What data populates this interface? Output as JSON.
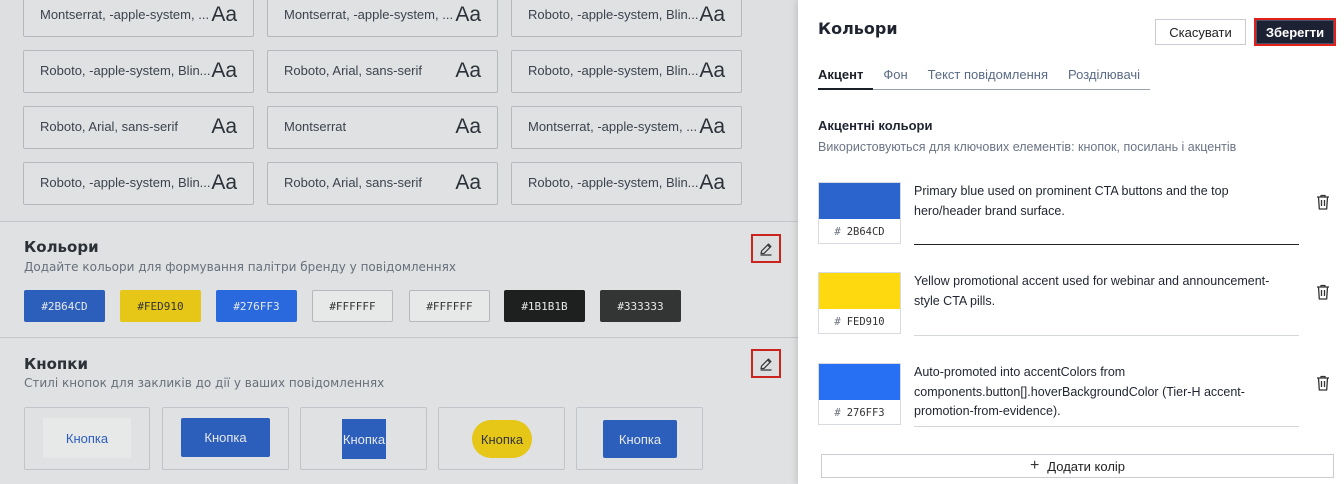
{
  "fonts_grid": [
    {
      "name": "Montserrat, -apple-system, ...",
      "sample": "Aa"
    },
    {
      "name": "Montserrat, -apple-system, ...",
      "sample": "Aa"
    },
    {
      "name": "Roboto, -apple-system, Blin...",
      "sample": "Aa"
    },
    {
      "name": "Roboto, -apple-system, Blin...",
      "sample": "Aa"
    },
    {
      "name": "Roboto, Arial, sans-serif",
      "sample": "Aa"
    },
    {
      "name": "Roboto, -apple-system, Blin...",
      "sample": "Aa"
    },
    {
      "name": "Roboto, Arial, sans-serif",
      "sample": "Aa"
    },
    {
      "name": "Montserrat",
      "sample": "Aa"
    },
    {
      "name": "Montserrat, -apple-system, ...",
      "sample": "Aa"
    },
    {
      "name": "Roboto, -apple-system, Blin...",
      "sample": "Aa"
    },
    {
      "name": "Roboto, Arial, sans-serif",
      "sample": "Aa"
    },
    {
      "name": "Roboto, -apple-system, Blin...",
      "sample": "Aa"
    }
  ],
  "colors_section": {
    "title": "Кольори",
    "subtitle": "Додайте кольори для формування палітри бренду у повідомленнях",
    "swatches": [
      {
        "label": "#2B64CD",
        "bg": "#2B64CD",
        "fg": "#ffffff"
      },
      {
        "label": "#FED910",
        "bg": "#FED910",
        "fg": "#333333"
      },
      {
        "label": "#276FF3",
        "bg": "#276FF3",
        "fg": "#ffffff"
      },
      {
        "label": "#FFFFFF",
        "bg": "#FFFFFF",
        "fg": "#333333"
      },
      {
        "label": "#FFFFFF",
        "bg": "#FFFFFF",
        "fg": "#333333"
      },
      {
        "label": "#1B1B1B",
        "bg": "#1B1B1B",
        "fg": "#ffffff"
      },
      {
        "label": "#333333",
        "bg": "#333333",
        "fg": "#ffffff"
      }
    ]
  },
  "buttons_section": {
    "title": "Кнопки",
    "subtitle": "Стилі кнопок для закликів до дії у ваших повідомленнях",
    "samples": [
      {
        "label": "Кнопка"
      },
      {
        "label": "Кнопка"
      },
      {
        "label": "Кнопка"
      },
      {
        "label": "Кнопка"
      },
      {
        "label": "Кнопка"
      }
    ]
  },
  "panel": {
    "title": "Кольори",
    "cancel_label": "Скасувати",
    "save_label": "Зберегти",
    "tabs": [
      {
        "label": "Акцент",
        "active": true
      },
      {
        "label": "Фон",
        "active": false
      },
      {
        "label": "Текст повідомлення",
        "active": false
      },
      {
        "label": "Розділювачі",
        "active": false
      }
    ],
    "section_title": "Акцентні кольори",
    "section_subtitle": "Використовуються для ключових елементів: кнопок, посилань і акцентів",
    "colors": [
      {
        "hex": "2B64CD",
        "color": "#2B64CD",
        "description": "Primary blue used on prominent CTA buttons and the top hero/header brand surface."
      },
      {
        "hex": "FED910",
        "color": "#FED910",
        "description": "Yellow promotional accent used for webinar and announcement-style CTA pills."
      },
      {
        "hex": "276FF3",
        "color": "#276FF3",
        "description": "Auto-promoted into accentColors from components.button[].hoverBackgroundColor (Tier-H accent-promotion-from-evidence)."
      }
    ],
    "hash_symbol": "#",
    "add_label": "Додати колір"
  }
}
